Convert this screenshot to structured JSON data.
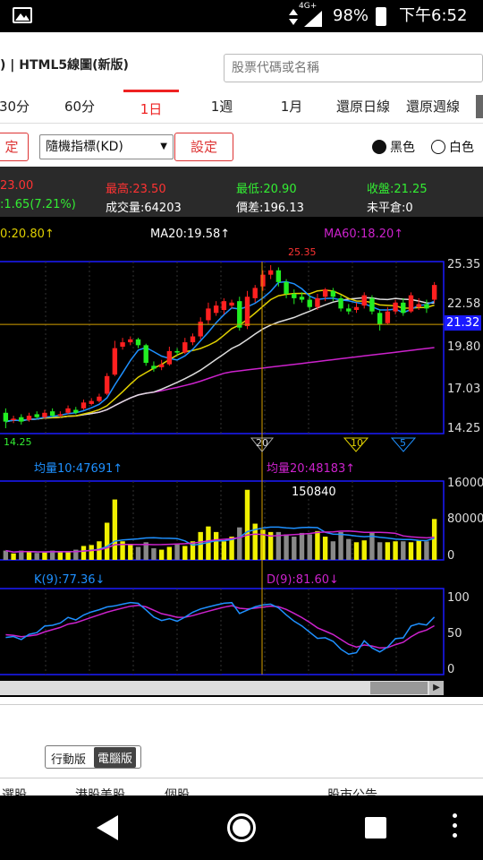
{
  "status_bar": {
    "network": "4G+",
    "battery": "98%",
    "time": "下午6:52"
  },
  "header": {
    "title": ") | HTML5線圖(新版)",
    "search_placeholder": "股票代碼或名稱"
  },
  "tabs": [
    {
      "label": "30分"
    },
    {
      "label": "60分"
    },
    {
      "label": "1日"
    },
    {
      "label": "1週"
    },
    {
      "label": "1月"
    },
    {
      "label": "還原日線"
    },
    {
      "label": "還原週線"
    }
  ],
  "controls": {
    "set_left": "定",
    "indicator_select": "隨機指標(KD)",
    "set_button": "設定",
    "theme_black": "黑色",
    "theme_white": "白色"
  },
  "quote": {
    "open": "23.00",
    "high_label": "最高:23.50",
    "low_label": "最低:20.90",
    "close_label": "收盤:21.25",
    "change": ":1.65(7.21%)",
    "volume_label": "成交量:64203",
    "spread_label": "價差:196.13",
    "uncovered_label": "未平倉:0"
  },
  "ma_labels": {
    "ma_left": "0:20.80↑",
    "ma20": "MA20:19.58↑",
    "ma60": "MA60:18.20↑"
  },
  "price_axis": [
    "25.35",
    "22.58",
    "19.80",
    "17.03",
    "14.25"
  ],
  "price_tags": {
    "high_marker": "25.35",
    "current": "21.32",
    "low_marker": "14.25"
  },
  "triangle_markers": [
    "20",
    "10",
    "5"
  ],
  "volume": {
    "ma10_label": "均量10:47691↑",
    "ma20_label": "均量20:48183↑",
    "peak_label": "150840",
    "axis": [
      "160000",
      "80000",
      "0"
    ]
  },
  "kd": {
    "k_label": "K(9):77.36↓",
    "d_label": "D(9):81.60↓",
    "axis": [
      "100",
      "50",
      "0"
    ]
  },
  "version_toggle": {
    "mobile": "行動版",
    "desktop": "電腦版"
  },
  "bottom_links": [
    "選股",
    "港股美股",
    "個股",
    "股市公告"
  ],
  "colors": {
    "up": "#ff2020",
    "down": "#22ee22",
    "ma5": "#1e90ff",
    "ma10": "#e0d000",
    "ma20": "#dddddd",
    "ma60": "#cc22cc",
    "axis_box": "#1a1aff",
    "current_line": "#d4a000"
  },
  "chart_data": {
    "type": "candlestick",
    "price_range": [
      14.25,
      25.35
    ],
    "candles": [
      {
        "o": 15.3,
        "c": 14.7,
        "h": 15.6,
        "l": 14.25
      },
      {
        "o": 14.8,
        "c": 14.9,
        "h": 15.1,
        "l": 14.6
      },
      {
        "o": 15.0,
        "c": 14.7,
        "h": 15.2,
        "l": 14.5
      },
      {
        "o": 14.8,
        "c": 15.1,
        "h": 15.3,
        "l": 14.7
      },
      {
        "o": 15.2,
        "c": 15.0,
        "h": 15.4,
        "l": 14.9
      },
      {
        "o": 15.0,
        "c": 15.3,
        "h": 15.5,
        "l": 14.9
      },
      {
        "o": 15.4,
        "c": 15.1,
        "h": 15.6,
        "l": 15.0
      },
      {
        "o": 15.2,
        "c": 15.2,
        "h": 15.4,
        "l": 15.0
      },
      {
        "o": 15.3,
        "c": 15.6,
        "h": 15.8,
        "l": 15.2
      },
      {
        "o": 15.5,
        "c": 15.3,
        "h": 15.7,
        "l": 15.2
      },
      {
        "o": 15.6,
        "c": 16.0,
        "h": 16.2,
        "l": 15.5
      },
      {
        "o": 15.9,
        "c": 16.1,
        "h": 16.3,
        "l": 15.8
      },
      {
        "o": 16.1,
        "c": 16.4,
        "h": 16.6,
        "l": 16.0
      },
      {
        "o": 16.6,
        "c": 17.8,
        "h": 18.0,
        "l": 16.5
      },
      {
        "o": 17.9,
        "c": 19.7,
        "h": 20.2,
        "l": 17.8
      },
      {
        "o": 19.8,
        "c": 20.1,
        "h": 20.4,
        "l": 19.6
      },
      {
        "o": 20.1,
        "c": 20.3,
        "h": 20.5,
        "l": 19.9
      },
      {
        "o": 20.3,
        "c": 19.9,
        "h": 20.4,
        "l": 19.7
      },
      {
        "o": 19.9,
        "c": 18.7,
        "h": 20.0,
        "l": 18.5
      },
      {
        "o": 18.5,
        "c": 18.3,
        "h": 18.8,
        "l": 18.1
      },
      {
        "o": 18.4,
        "c": 18.6,
        "h": 18.9,
        "l": 18.2
      },
      {
        "o": 18.6,
        "c": 19.5,
        "h": 19.8,
        "l": 18.5
      },
      {
        "o": 19.5,
        "c": 19.4,
        "h": 19.7,
        "l": 19.2
      },
      {
        "o": 19.4,
        "c": 20.1,
        "h": 20.4,
        "l": 19.3
      },
      {
        "o": 20.1,
        "c": 20.5,
        "h": 20.7,
        "l": 19.9
      },
      {
        "o": 20.5,
        "c": 21.5,
        "h": 21.8,
        "l": 20.3
      },
      {
        "o": 21.6,
        "c": 22.4,
        "h": 22.8,
        "l": 21.3
      },
      {
        "o": 22.1,
        "c": 22.6,
        "h": 22.9,
        "l": 21.9
      },
      {
        "o": 22.3,
        "c": 22.9,
        "h": 23.1,
        "l": 22.0
      },
      {
        "o": 22.6,
        "c": 22.8,
        "h": 23.0,
        "l": 22.4
      },
      {
        "o": 22.9,
        "c": 21.1,
        "h": 23.2,
        "l": 20.9
      },
      {
        "o": 21.2,
        "c": 23.2,
        "h": 23.6,
        "l": 21.0
      },
      {
        "o": 23.1,
        "c": 23.8,
        "h": 24.0,
        "l": 22.8
      },
      {
        "o": 23.9,
        "c": 24.7,
        "h": 25.0,
        "l": 23.6
      },
      {
        "o": 24.7,
        "c": 25.0,
        "h": 25.35,
        "l": 24.4
      },
      {
        "o": 25.0,
        "c": 24.2,
        "h": 25.2,
        "l": 23.9
      },
      {
        "o": 24.2,
        "c": 23.4,
        "h": 24.4,
        "l": 23.1
      },
      {
        "o": 23.4,
        "c": 23.1,
        "h": 23.7,
        "l": 22.7
      },
      {
        "o": 23.2,
        "c": 23.0,
        "h": 23.5,
        "l": 22.8
      },
      {
        "o": 23.0,
        "c": 22.5,
        "h": 23.3,
        "l": 22.3
      },
      {
        "o": 22.5,
        "c": 23.1,
        "h": 23.4,
        "l": 22.3
      },
      {
        "o": 23.2,
        "c": 23.7,
        "h": 23.8,
        "l": 22.9
      },
      {
        "o": 23.6,
        "c": 23.2,
        "h": 23.8,
        "l": 22.9
      },
      {
        "o": 23.1,
        "c": 22.4,
        "h": 23.3,
        "l": 22.2
      },
      {
        "o": 22.4,
        "c": 22.2,
        "h": 22.7,
        "l": 22.0
      },
      {
        "o": 22.3,
        "c": 22.5,
        "h": 22.8,
        "l": 22.1
      },
      {
        "o": 22.6,
        "c": 23.3,
        "h": 23.5,
        "l": 22.4
      },
      {
        "o": 23.1,
        "c": 22.2,
        "h": 23.3,
        "l": 22.0
      },
      {
        "o": 22.1,
        "c": 21.3,
        "h": 22.3,
        "l": 20.9
      },
      {
        "o": 21.4,
        "c": 22.2,
        "h": 22.5,
        "l": 21.3
      },
      {
        "o": 22.2,
        "c": 22.8,
        "h": 23.0,
        "l": 22.0
      },
      {
        "o": 22.8,
        "c": 22.1,
        "h": 23.1,
        "l": 21.9
      },
      {
        "o": 22.2,
        "c": 23.3,
        "h": 23.5,
        "l": 22.1
      },
      {
        "o": 22.5,
        "c": 22.7,
        "h": 23.1,
        "l": 22.3
      },
      {
        "o": 22.7,
        "c": 22.4,
        "h": 23.0,
        "l": 22.1
      },
      {
        "o": 23.0,
        "c": 24.0,
        "h": 24.2,
        "l": 22.8
      }
    ],
    "volumes": [
      20000,
      14000,
      20000,
      18000,
      15000,
      16000,
      20000,
      17000,
      18000,
      22000,
      30000,
      32000,
      40000,
      80000,
      130000,
      40000,
      33000,
      28000,
      38000,
      25000,
      22000,
      28000,
      35000,
      30000,
      40000,
      60000,
      72000,
      60000,
      40000,
      50000,
      70000,
      150840,
      78000,
      65000,
      60000,
      60000,
      55000,
      50000,
      58000,
      55000,
      62000,
      50000,
      40000,
      60000,
      45000,
      38000,
      42000,
      58000,
      38000,
      38000,
      40000,
      40000,
      38000,
      42000,
      40000,
      88000
    ],
    "volume_range": [
      0,
      160000
    ],
    "kd_range": [
      0,
      100
    ],
    "current_price": 21.32,
    "ma20": 19.58,
    "ma60": 18.2
  }
}
